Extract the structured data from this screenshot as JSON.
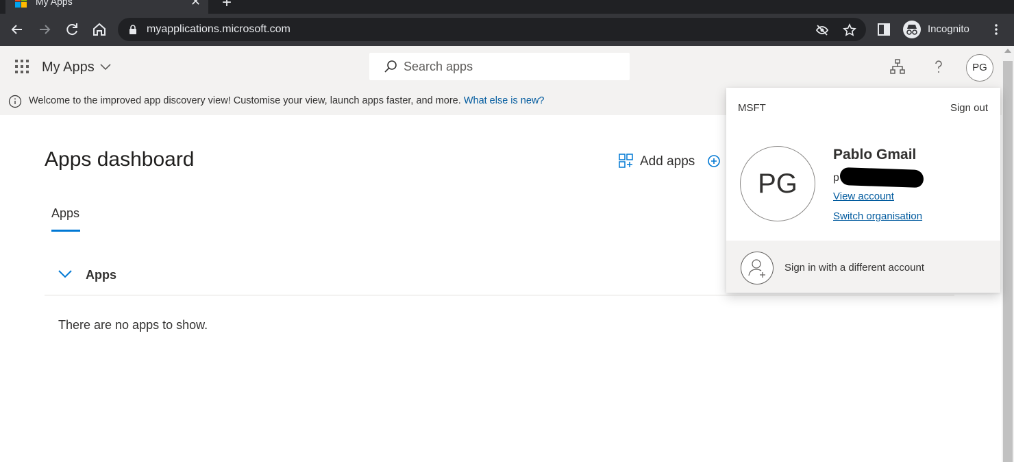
{
  "browser": {
    "tab_title": "My Apps",
    "url_host": "myapplications.microsoft.com",
    "url_prefix": "myapplications.mic",
    "url_suffix": "rosoft.com",
    "incognito_label": "Incognito"
  },
  "header": {
    "brand": "My Apps",
    "search_placeholder": "Search apps",
    "avatar_initials": "PG"
  },
  "banner": {
    "text": "Welcome to the improved app discovery view! Customise your view, launch apps faster, and more.",
    "link": "What else is new?"
  },
  "main": {
    "title": "Apps dashboard",
    "add_apps_label": "Add apps",
    "tabs": [
      {
        "label": "Apps"
      }
    ],
    "group_label": "Apps",
    "empty_text": "There are no apps to show."
  },
  "account_panel": {
    "org": "MSFT",
    "sign_out": "Sign out",
    "initials": "PG",
    "name": "Pablo Gmail",
    "email_visible": "p",
    "view_account": "View account",
    "switch_org": "Switch organisation",
    "different_account": "Sign in with a different account"
  },
  "colors": {
    "accent": "#0078d4",
    "link": "#005a9e",
    "chrome_dark": "#35363a",
    "header_bg": "#f3f2f1"
  }
}
